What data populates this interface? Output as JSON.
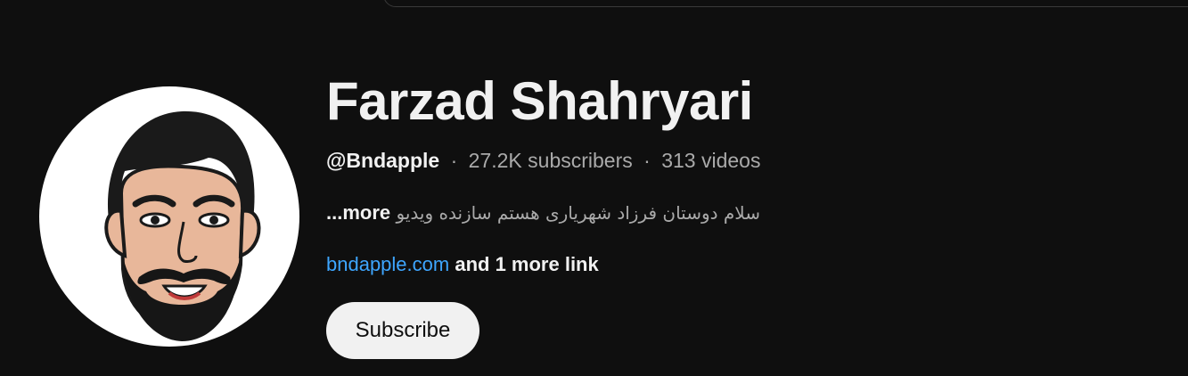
{
  "channel": {
    "name": "Farzad Shahryari",
    "handle": "@Bndapple",
    "subscribers": "27.2K subscribers",
    "videos": "313 videos",
    "separator": "·",
    "description": "سلام دوستان فرزاد شهریاری هستم سازنده ویدیو",
    "description_more": "...more",
    "link_text": "bndapple.com",
    "more_links": "and 1 more link"
  },
  "actions": {
    "subscribe_label": "Subscribe"
  },
  "colors": {
    "background": "#0f0f0f",
    "link": "#3ea6ff",
    "secondary_text": "#aaaaaa",
    "primary_text": "#f1f1f1"
  }
}
